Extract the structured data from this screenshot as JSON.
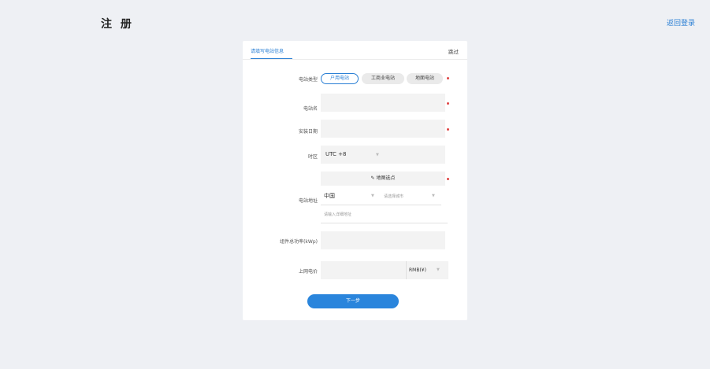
{
  "header": {
    "title": "注 册",
    "back_link": "返回登录"
  },
  "card": {
    "tab_label": "请填写电站信息",
    "skip_label": "跳过",
    "station_type": {
      "label": "电站类型",
      "options": [
        "户用电站",
        "工商业电站",
        "地面电站"
      ],
      "selected": "户用电站"
    },
    "station_name": {
      "label": "电站名",
      "value": ""
    },
    "install_date": {
      "label": "安装日期",
      "value": ""
    },
    "timezone": {
      "label": "时区",
      "value": "UTC +8"
    },
    "address": {
      "label": "电站地址",
      "map_button": "地图选点",
      "country": "中国",
      "region_placeholder": "请选择城市",
      "detail_placeholder": "请输入详细地址"
    },
    "capacity": {
      "label": "组件总功率(kWp)",
      "value": ""
    },
    "price": {
      "label": "上网电价",
      "value": "",
      "currency": "RMB(¥)"
    },
    "next_button": "下一步"
  },
  "colors": {
    "accent": "#2a7fd4",
    "required": "#e04545",
    "background": "#eef0f4"
  },
  "icons": [
    "pencil-icon",
    "chevron-down-icon",
    "required-dot"
  ]
}
